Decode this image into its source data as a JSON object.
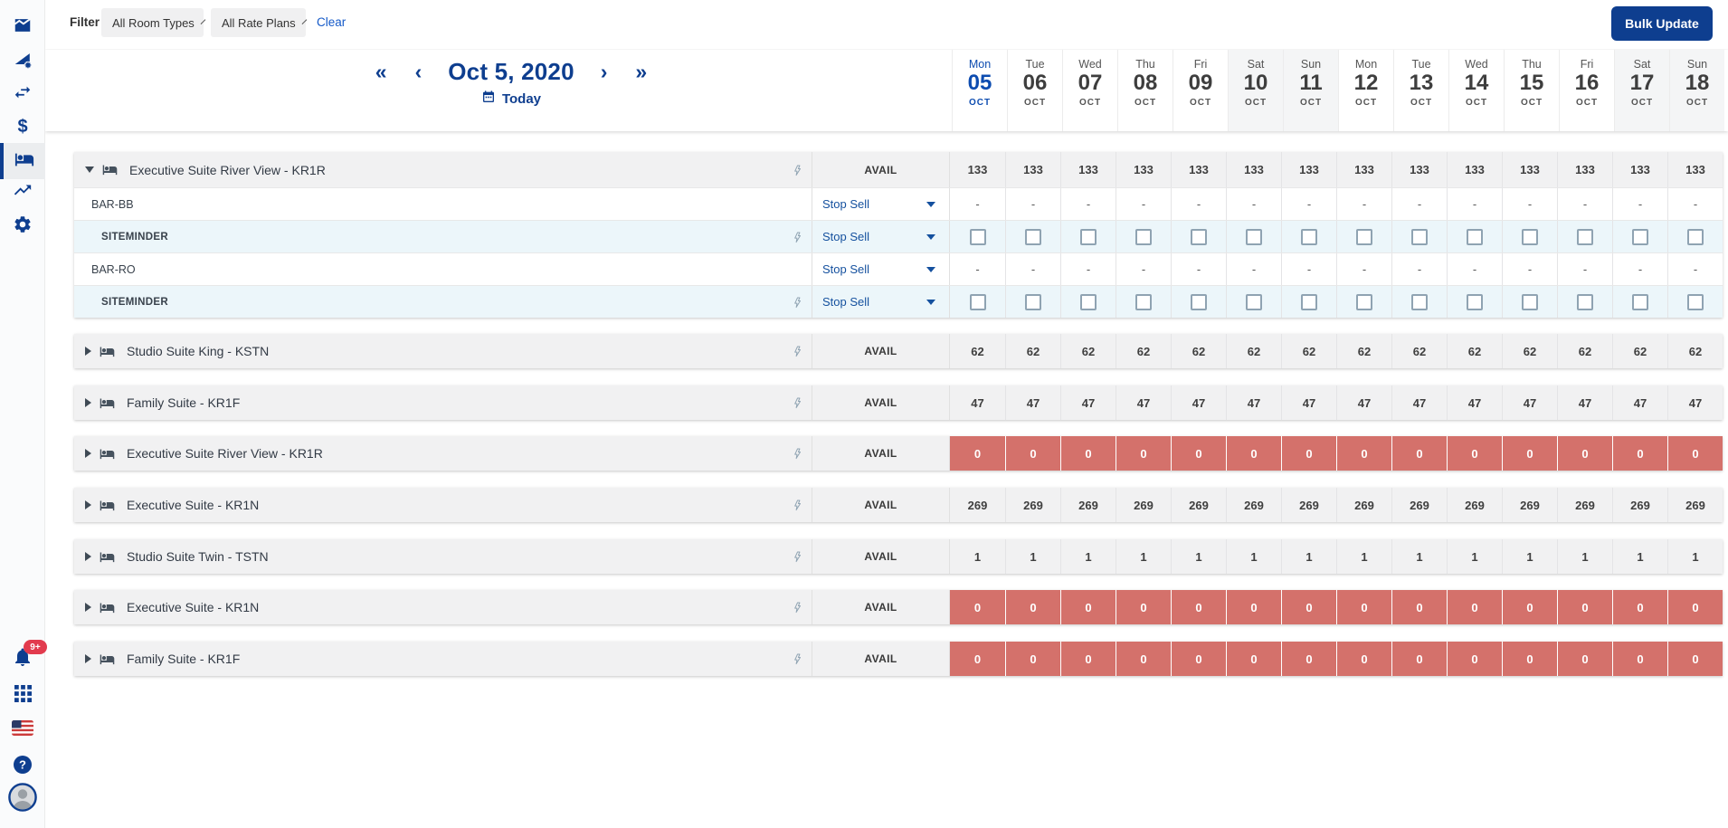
{
  "colors": {
    "brand": "#0e3e8f",
    "link": "#1459c8",
    "zero_cell_red": "#d4716b",
    "row_gray": "#f1f1f2",
    "channel_row_blue": "#ecf6fa",
    "weekend_gray": "#f4f5f6",
    "badge_red": "#e23b4e"
  },
  "sidebar": {
    "items": [
      {
        "icon": "area-chart-icon",
        "selected": false
      },
      {
        "icon": "trend-settings-icon",
        "selected": false
      },
      {
        "icon": "swap-horizontal-icon",
        "selected": false
      },
      {
        "icon": "dollar-icon",
        "selected": false
      },
      {
        "icon": "rooms-bed-icon",
        "selected": true
      },
      {
        "icon": "trending-up-icon",
        "selected": false
      },
      {
        "icon": "settings-gear-icon",
        "selected": false
      }
    ],
    "bottom_items": [
      {
        "icon": "bell-icon",
        "badge": "9+"
      },
      {
        "icon": "apps-grid-icon"
      },
      {
        "icon": "us-flag-icon"
      },
      {
        "icon": "help-icon"
      },
      {
        "icon": "avatar"
      }
    ]
  },
  "filter_bar": {
    "label": "Filter",
    "room_types_value": "All Room Types",
    "rate_plans_value": "All Rate Plans",
    "clear_label": "Clear",
    "bulk_update_label": "Bulk Update"
  },
  "calendar_nav": {
    "first": "«",
    "prev": "‹",
    "date_label": "Oct 5, 2020",
    "next": "›",
    "last": "»",
    "today_label": "Today"
  },
  "dates": [
    {
      "dow": "Mon",
      "day": "05",
      "month": "OCT",
      "today": true,
      "weekend": false
    },
    {
      "dow": "Tue",
      "day": "06",
      "month": "OCT",
      "today": false,
      "weekend": false
    },
    {
      "dow": "Wed",
      "day": "07",
      "month": "OCT",
      "today": false,
      "weekend": false
    },
    {
      "dow": "Thu",
      "day": "08",
      "month": "OCT",
      "today": false,
      "weekend": false
    },
    {
      "dow": "Fri",
      "day": "09",
      "month": "OCT",
      "today": false,
      "weekend": false
    },
    {
      "dow": "Sat",
      "day": "10",
      "month": "OCT",
      "today": false,
      "weekend": true
    },
    {
      "dow": "Sun",
      "day": "11",
      "month": "OCT",
      "today": false,
      "weekend": true
    },
    {
      "dow": "Mon",
      "day": "12",
      "month": "OCT",
      "today": false,
      "weekend": false
    },
    {
      "dow": "Tue",
      "day": "13",
      "month": "OCT",
      "today": false,
      "weekend": false
    },
    {
      "dow": "Wed",
      "day": "14",
      "month": "OCT",
      "today": false,
      "weekend": false
    },
    {
      "dow": "Thu",
      "day": "15",
      "month": "OCT",
      "today": false,
      "weekend": false
    },
    {
      "dow": "Fri",
      "day": "16",
      "month": "OCT",
      "today": false,
      "weekend": false
    },
    {
      "dow": "Sat",
      "day": "17",
      "month": "OCT",
      "today": false,
      "weekend": true
    },
    {
      "dow": "Sun",
      "day": "18",
      "month": "OCT",
      "today": false,
      "weekend": true
    }
  ],
  "grid": {
    "avail_label": "AVAIL",
    "stop_sell_label": "Stop Sell",
    "dash": "-",
    "groups": [
      {
        "name": "Executive Suite River View - KR1R",
        "expanded": true,
        "zero": false,
        "day_values": [
          "133",
          "133",
          "133",
          "133",
          "133",
          "133",
          "133",
          "133",
          "133",
          "133",
          "133",
          "133",
          "133",
          "133"
        ],
        "rate_plans": [
          {
            "label": "BAR-BB",
            "kind": "dash"
          },
          {
            "label": "SITEMINDER",
            "kind": "checkbox"
          },
          {
            "label": "BAR-RO",
            "kind": "dash"
          },
          {
            "label": "SITEMINDER",
            "kind": "checkbox"
          }
        ]
      },
      {
        "name": "Studio Suite King - KSTN",
        "expanded": false,
        "zero": false,
        "day_values": [
          "62",
          "62",
          "62",
          "62",
          "62",
          "62",
          "62",
          "62",
          "62",
          "62",
          "62",
          "62",
          "62",
          "62"
        ]
      },
      {
        "name": "Family Suite - KR1F",
        "expanded": false,
        "zero": false,
        "day_values": [
          "47",
          "47",
          "47",
          "47",
          "47",
          "47",
          "47",
          "47",
          "47",
          "47",
          "47",
          "47",
          "47",
          "47"
        ]
      },
      {
        "name": "Executive Suite River View - KR1R",
        "expanded": false,
        "zero": true,
        "day_values": [
          "0",
          "0",
          "0",
          "0",
          "0",
          "0",
          "0",
          "0",
          "0",
          "0",
          "0",
          "0",
          "0",
          "0"
        ]
      },
      {
        "name": "Executive Suite - KR1N",
        "expanded": false,
        "zero": false,
        "day_values": [
          "269",
          "269",
          "269",
          "269",
          "269",
          "269",
          "269",
          "269",
          "269",
          "269",
          "269",
          "269",
          "269",
          "269"
        ]
      },
      {
        "name": "Studio Suite Twin - TSTN",
        "expanded": false,
        "zero": false,
        "day_values": [
          "1",
          "1",
          "1",
          "1",
          "1",
          "1",
          "1",
          "1",
          "1",
          "1",
          "1",
          "1",
          "1",
          "1"
        ]
      },
      {
        "name": "Executive Suite - KR1N",
        "expanded": false,
        "zero": true,
        "day_values": [
          "0",
          "0",
          "0",
          "0",
          "0",
          "0",
          "0",
          "0",
          "0",
          "0",
          "0",
          "0",
          "0",
          "0"
        ]
      },
      {
        "name": "Family Suite - KR1F",
        "expanded": false,
        "zero": true,
        "day_values": [
          "0",
          "0",
          "0",
          "0",
          "0",
          "0",
          "0",
          "0",
          "0",
          "0",
          "0",
          "0",
          "0",
          "0"
        ]
      }
    ]
  }
}
